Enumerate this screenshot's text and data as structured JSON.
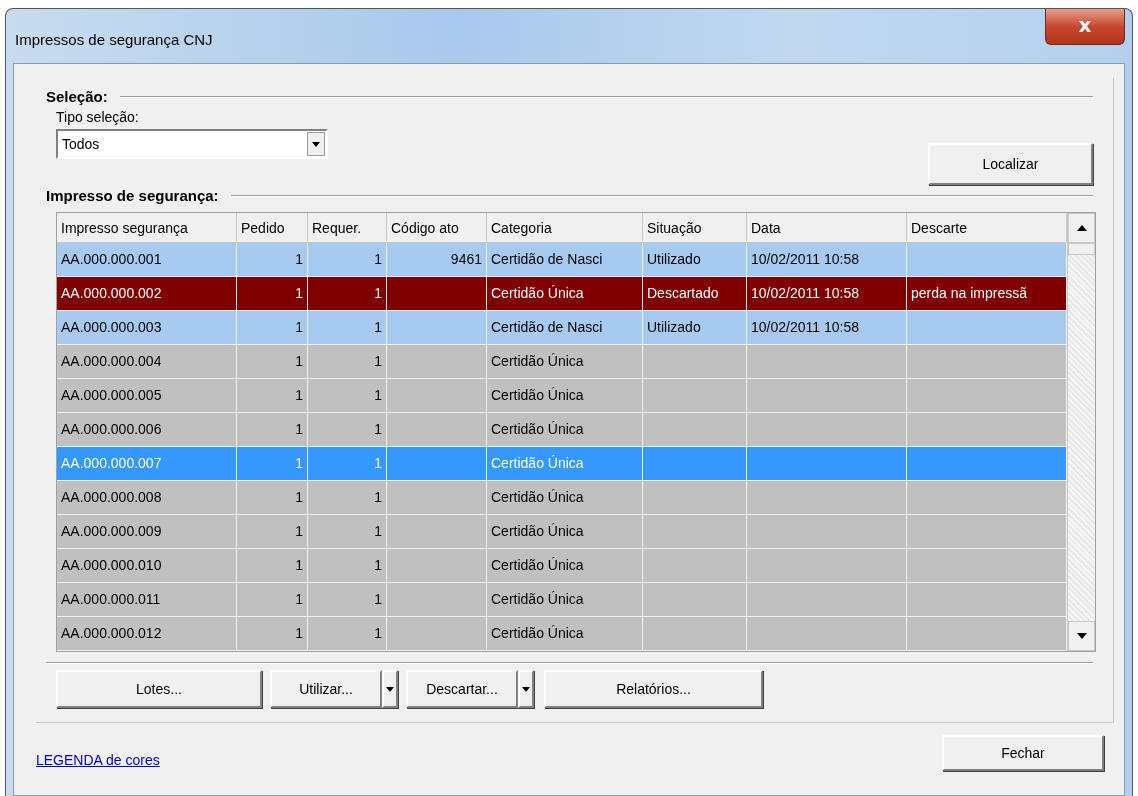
{
  "window": {
    "title": "Impressos de segurança CNJ",
    "close": "x"
  },
  "selection": {
    "heading": "Seleção:",
    "type_label": "Tipo seleção:",
    "type_value": "Todos",
    "find_button": {
      "label": "Localizar"
    }
  },
  "table": {
    "heading": "Impresso de segurança:",
    "columns": [
      "Impresso segurança",
      "Pedido",
      "Requer.",
      "Código ato",
      "Categoria",
      "Situação",
      "Data",
      "Descarte"
    ],
    "rows": [
      {
        "cells": [
          "AA.000.000.001",
          "1",
          "1",
          "9461",
          "Certidão de Nasci",
          "Utilizado",
          "10/02/2011 10:58",
          ""
        ],
        "color": "#a6caf0",
        "selected": false
      },
      {
        "cells": [
          "AA.000.000.002",
          "1",
          "1",
          "",
          "Certidão Única",
          "Descartado",
          "10/02/2011 10:58",
          "perda na impressã"
        ],
        "color": "#800000",
        "selected": false
      },
      {
        "cells": [
          "AA.000.000.003",
          "1",
          "1",
          "",
          "Certidão de Nasci",
          "Utilizado",
          "10/02/2011 10:58",
          ""
        ],
        "color": "#a6caf0",
        "selected": false
      },
      {
        "cells": [
          "AA.000.000.004",
          "1",
          "1",
          "",
          "Certidão Única",
          "",
          "",
          ""
        ],
        "color": "#c0c0c0",
        "selected": false
      },
      {
        "cells": [
          "AA.000.000.005",
          "1",
          "1",
          "",
          "Certidão Única",
          "",
          "",
          ""
        ],
        "color": "#c0c0c0",
        "selected": false
      },
      {
        "cells": [
          "AA.000.000.006",
          "1",
          "1",
          "",
          "Certidão Única",
          "",
          "",
          ""
        ],
        "color": "#c0c0c0",
        "selected": false
      },
      {
        "cells": [
          "AA.000.000.007",
          "1",
          "1",
          "",
          "Certidão Única",
          "",
          "",
          ""
        ],
        "selected": true
      },
      {
        "cells": [
          "AA.000.000.008",
          "1",
          "1",
          "",
          "Certidão Única",
          "",
          "",
          ""
        ],
        "color": "#c0c0c0",
        "selected": false
      },
      {
        "cells": [
          "AA.000.000.009",
          "1",
          "1",
          "",
          "Certidão Única",
          "",
          "",
          ""
        ],
        "color": "#c0c0c0",
        "selected": false
      },
      {
        "cells": [
          "AA.000.000.010",
          "1",
          "1",
          "",
          "Certidão Única",
          "",
          "",
          ""
        ],
        "color": "#c0c0c0",
        "selected": false
      },
      {
        "cells": [
          "AA.000.000.011",
          "1",
          "1",
          "",
          "Certidão Única",
          "",
          "",
          ""
        ],
        "color": "#c0c0c0",
        "selected": false
      },
      {
        "cells": [
          "AA.000.000.012",
          "1",
          "1",
          "",
          "Certidão Única",
          "",
          "",
          ""
        ],
        "color": "#c0c0c0",
        "selected": false
      }
    ]
  },
  "actions": [
    {
      "label": "Lotes...",
      "kind": "plain"
    },
    {
      "label": "Utilizar...",
      "kind": "split"
    },
    {
      "label": "Descartar...",
      "kind": "split"
    },
    {
      "label": "Relatórios...",
      "kind": "plain"
    }
  ],
  "legend_link": "LEGENDA de cores",
  "close_button": {
    "label": "Fechar"
  }
}
